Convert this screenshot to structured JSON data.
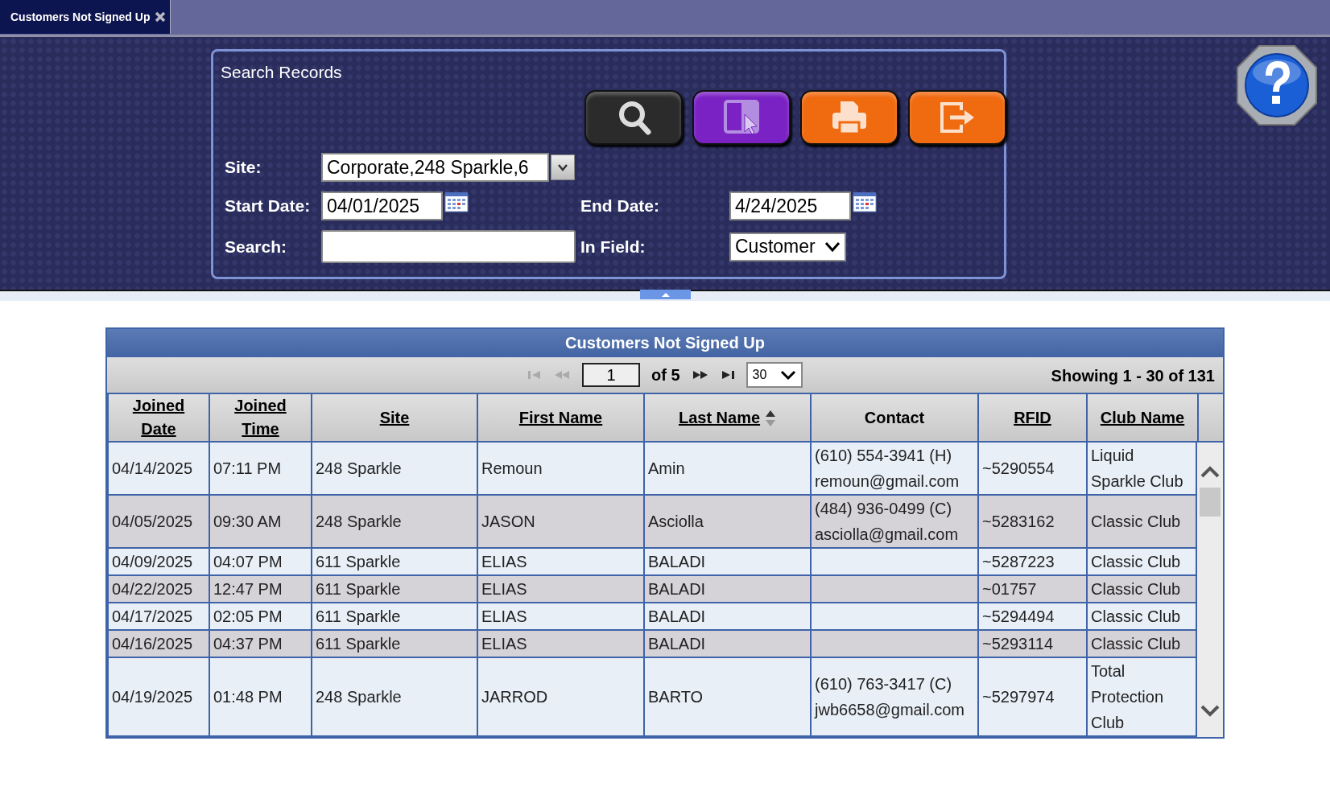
{
  "tabs": [
    {
      "label": "Customers Not Signed Up",
      "selected": true
    }
  ],
  "search_panel": {
    "title": "Search Records",
    "toolbar_buttons": [
      {
        "kind": "search",
        "color": "#2b2b2b"
      },
      {
        "kind": "columns",
        "color": "#7a22c4"
      },
      {
        "kind": "print",
        "color": "#f06a10"
      },
      {
        "kind": "export",
        "color": "#f06a10"
      }
    ],
    "site": {
      "label": "Site:",
      "value": "Corporate,248 Sparkle,6"
    },
    "start_date": {
      "label": "Start Date:",
      "value": "04/01/2025"
    },
    "end_date": {
      "label": "End Date:",
      "value": "4/24/2025"
    },
    "search": {
      "label": "Search:"
    },
    "in_field": {
      "label": "In Field:",
      "value": "Customer"
    }
  },
  "table": {
    "title": "Customers Not Signed Up",
    "pager": {
      "page": "1",
      "of": "of 5",
      "page_size": "30",
      "showing": "Showing 1 - 30 of 131"
    },
    "columns": [
      {
        "label": "Joined Date",
        "sortable": true,
        "sorted": false
      },
      {
        "label": "Joined Time",
        "sortable": true,
        "sorted": false
      },
      {
        "label": "Site",
        "sortable": true,
        "sorted": false
      },
      {
        "label": "First Name",
        "sortable": true,
        "sorted": false
      },
      {
        "label": "Last Name",
        "sortable": true,
        "sorted": true
      },
      {
        "label": "Contact",
        "sortable": false,
        "sorted": false
      },
      {
        "label": "RFID",
        "sortable": true,
        "sorted": false
      },
      {
        "label": "Club Name",
        "sortable": true,
        "sorted": false
      }
    ],
    "rows": [
      {
        "joined_date": "04/14/2025",
        "joined_time": "07:11 PM",
        "site": "248 Sparkle",
        "first_name": "Remoun",
        "last_name": "Amin",
        "phone": "(610) 554-3941 (H)",
        "email": "remoun@gmail.com",
        "rfid": "~5290554",
        "club_name": "Liquid Sparkle Club"
      },
      {
        "joined_date": "04/05/2025",
        "joined_time": "09:30 AM",
        "site": "248 Sparkle",
        "first_name": "JASON",
        "last_name": "Asciolla",
        "phone": "(484) 936-0499 (C)",
        "email": "asciolla@gmail.com",
        "rfid": "~5283162",
        "club_name": "Classic Club"
      },
      {
        "joined_date": "04/09/2025",
        "joined_time": "04:07 PM",
        "site": "611 Sparkle",
        "first_name": "ELIAS",
        "last_name": "BALADI",
        "rfid": "~5287223",
        "club_name": "Classic Club"
      },
      {
        "joined_date": "04/22/2025",
        "joined_time": "12:47 PM",
        "site": "611 Sparkle",
        "first_name": "ELIAS",
        "last_name": "BALADI",
        "rfid": "~01757",
        "club_name": "Classic Club"
      },
      {
        "joined_date": "04/17/2025",
        "joined_time": "02:05 PM",
        "site": "611 Sparkle",
        "first_name": "ELIAS",
        "last_name": "BALADI",
        "rfid": "~5294494",
        "club_name": "Classic Club"
      },
      {
        "joined_date": "04/16/2025",
        "joined_time": "04:37 PM",
        "site": "611 Sparkle",
        "first_name": "ELIAS",
        "last_name": "BALADI",
        "rfid": "~5293114",
        "club_name": "Classic Club"
      },
      {
        "joined_date": "04/19/2025",
        "joined_time": "01:48 PM",
        "site": "248 Sparkle",
        "first_name": "JARROD",
        "last_name": "BARTO",
        "phone": "(610) 763-3417 (C)",
        "email": "jwb6658@gmail.com",
        "rfid": "~5297974",
        "club_name": "Total Protection Club"
      }
    ]
  }
}
